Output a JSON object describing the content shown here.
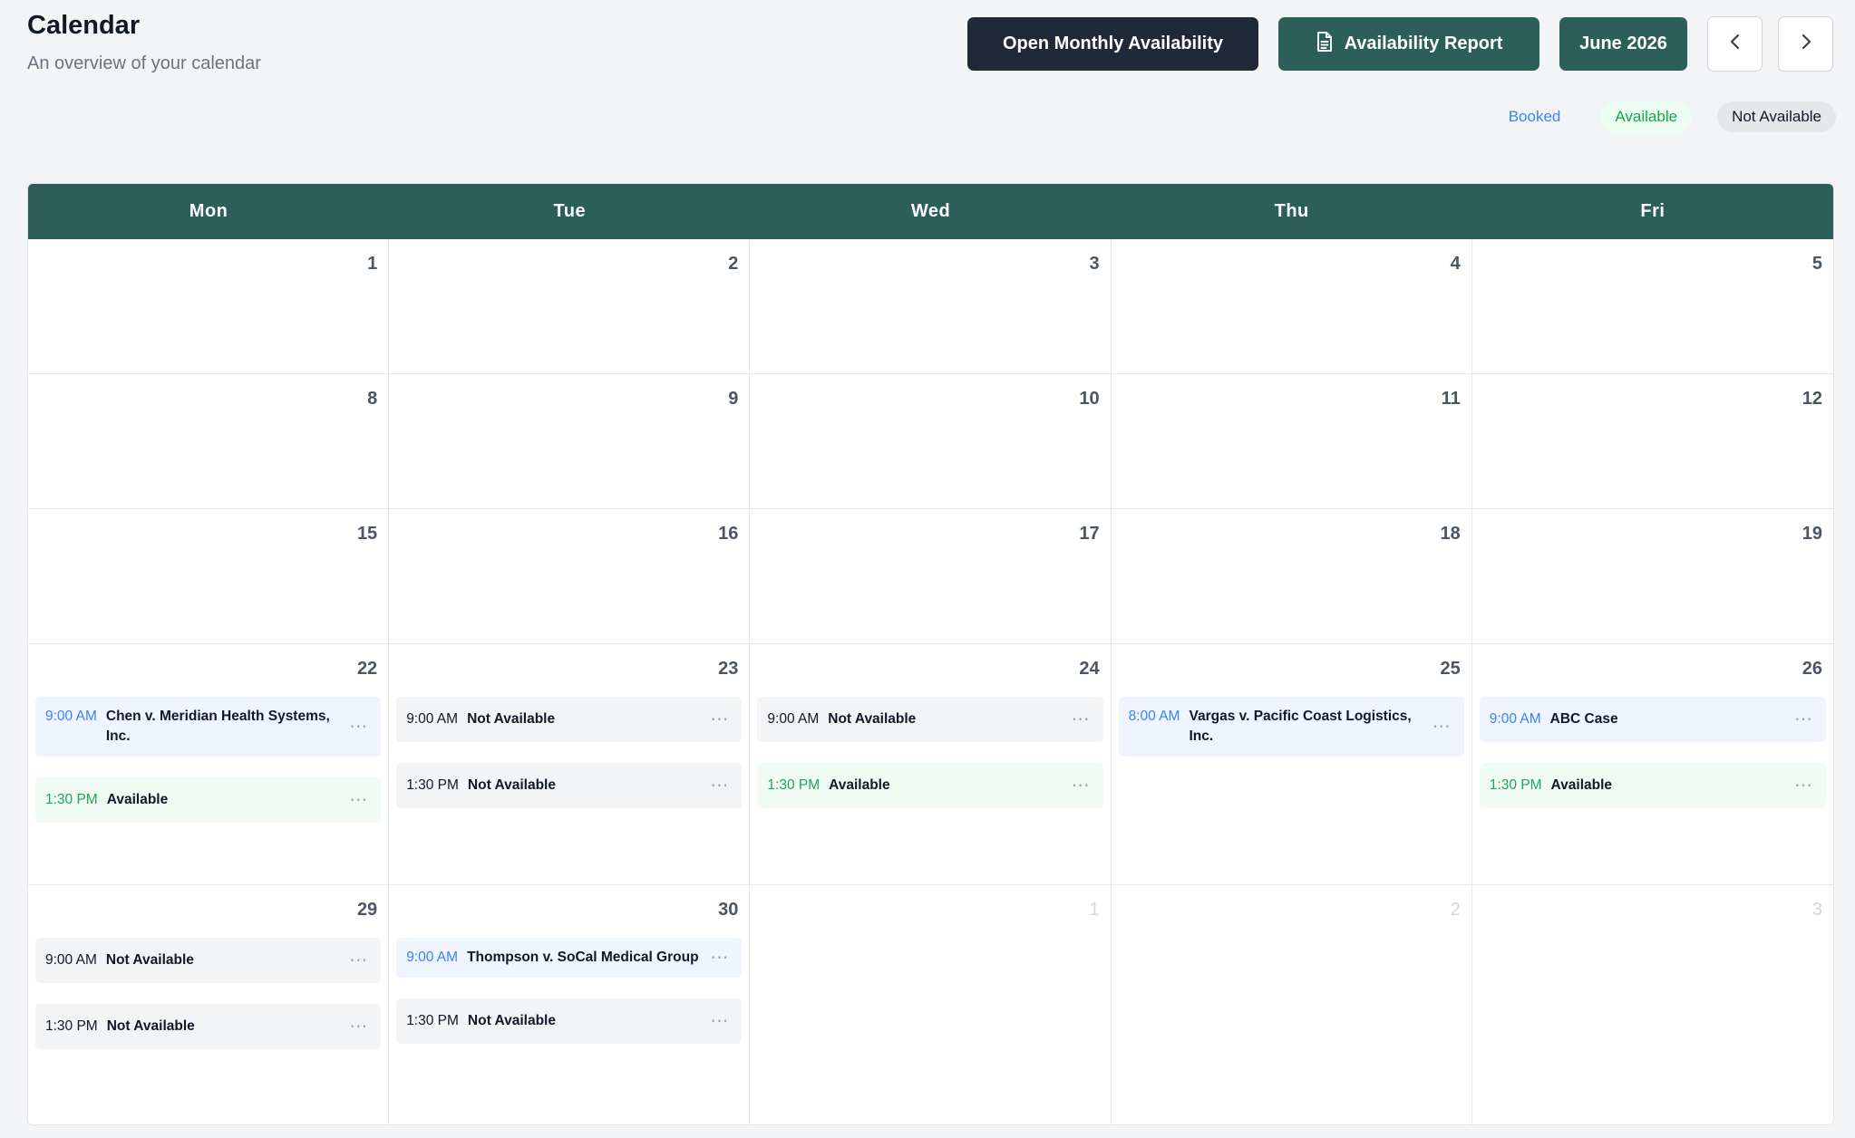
{
  "header": {
    "title": "Calendar",
    "subtitle": "An overview of your calendar"
  },
  "toolbar": {
    "open_monthly_label": "Open Monthly Availability",
    "report_label": "Availability Report",
    "month_label": "June 2026",
    "prev_icon": "chevron-left-icon",
    "next_icon": "chevron-right-icon"
  },
  "legend": {
    "booked": "Booked",
    "available": "Available",
    "not_available": "Not Available"
  },
  "colors": {
    "brand_green": "#2c5f59",
    "dark_button": "#1f2937",
    "booked": "#3b82f6",
    "available": "#22a35a",
    "not_available": "#111827"
  },
  "calendar": {
    "weekdays": [
      "Mon",
      "Tue",
      "Wed",
      "Thu",
      "Fri"
    ],
    "cells": [
      {
        "date": "1",
        "muted": false,
        "events": []
      },
      {
        "date": "2",
        "muted": false,
        "events": []
      },
      {
        "date": "3",
        "muted": false,
        "events": []
      },
      {
        "date": "4",
        "muted": false,
        "events": []
      },
      {
        "date": "5",
        "muted": false,
        "events": []
      },
      {
        "date": "8",
        "muted": false,
        "events": []
      },
      {
        "date": "9",
        "muted": false,
        "events": []
      },
      {
        "date": "10",
        "muted": false,
        "events": []
      },
      {
        "date": "11",
        "muted": false,
        "events": []
      },
      {
        "date": "12",
        "muted": false,
        "events": []
      },
      {
        "date": "15",
        "muted": false,
        "events": []
      },
      {
        "date": "16",
        "muted": false,
        "events": []
      },
      {
        "date": "17",
        "muted": false,
        "events": []
      },
      {
        "date": "18",
        "muted": false,
        "events": []
      },
      {
        "date": "19",
        "muted": false,
        "events": []
      },
      {
        "date": "22",
        "muted": false,
        "events": [
          {
            "time": "9:00 AM",
            "title": "Chen v. Meridian Health Systems, Inc.",
            "status": "booked"
          },
          {
            "time": "1:30 PM",
            "title": "Available",
            "status": "available"
          }
        ]
      },
      {
        "date": "23",
        "muted": false,
        "events": [
          {
            "time": "9:00 AM",
            "title": "Not Available",
            "status": "na"
          },
          {
            "time": "1:30 PM",
            "title": "Not Available",
            "status": "na"
          }
        ]
      },
      {
        "date": "24",
        "muted": false,
        "events": [
          {
            "time": "9:00 AM",
            "title": "Not Available",
            "status": "na"
          },
          {
            "time": "1:30 PM",
            "title": "Available",
            "status": "available"
          }
        ]
      },
      {
        "date": "25",
        "muted": false,
        "events": [
          {
            "time": "8:00 AM",
            "title": "Vargas v. Pacific Coast Logistics, Inc.",
            "status": "booked"
          }
        ]
      },
      {
        "date": "26",
        "muted": false,
        "events": [
          {
            "time": "9:00 AM",
            "title": "ABC Case",
            "status": "booked"
          },
          {
            "time": "1:30 PM",
            "title": "Available",
            "status": "available"
          }
        ]
      },
      {
        "date": "29",
        "muted": false,
        "events": [
          {
            "time": "9:00 AM",
            "title": "Not Available",
            "status": "na"
          },
          {
            "time": "1:30 PM",
            "title": "Not Available",
            "status": "na"
          }
        ]
      },
      {
        "date": "30",
        "muted": false,
        "events": [
          {
            "time": "9:00 AM",
            "title": "Thompson v. SoCal Medical Group",
            "status": "booked"
          },
          {
            "time": "1:30 PM",
            "title": "Not Available",
            "status": "na"
          }
        ]
      },
      {
        "date": "1",
        "muted": true,
        "events": []
      },
      {
        "date": "2",
        "muted": true,
        "events": []
      },
      {
        "date": "3",
        "muted": true,
        "events": []
      }
    ]
  }
}
